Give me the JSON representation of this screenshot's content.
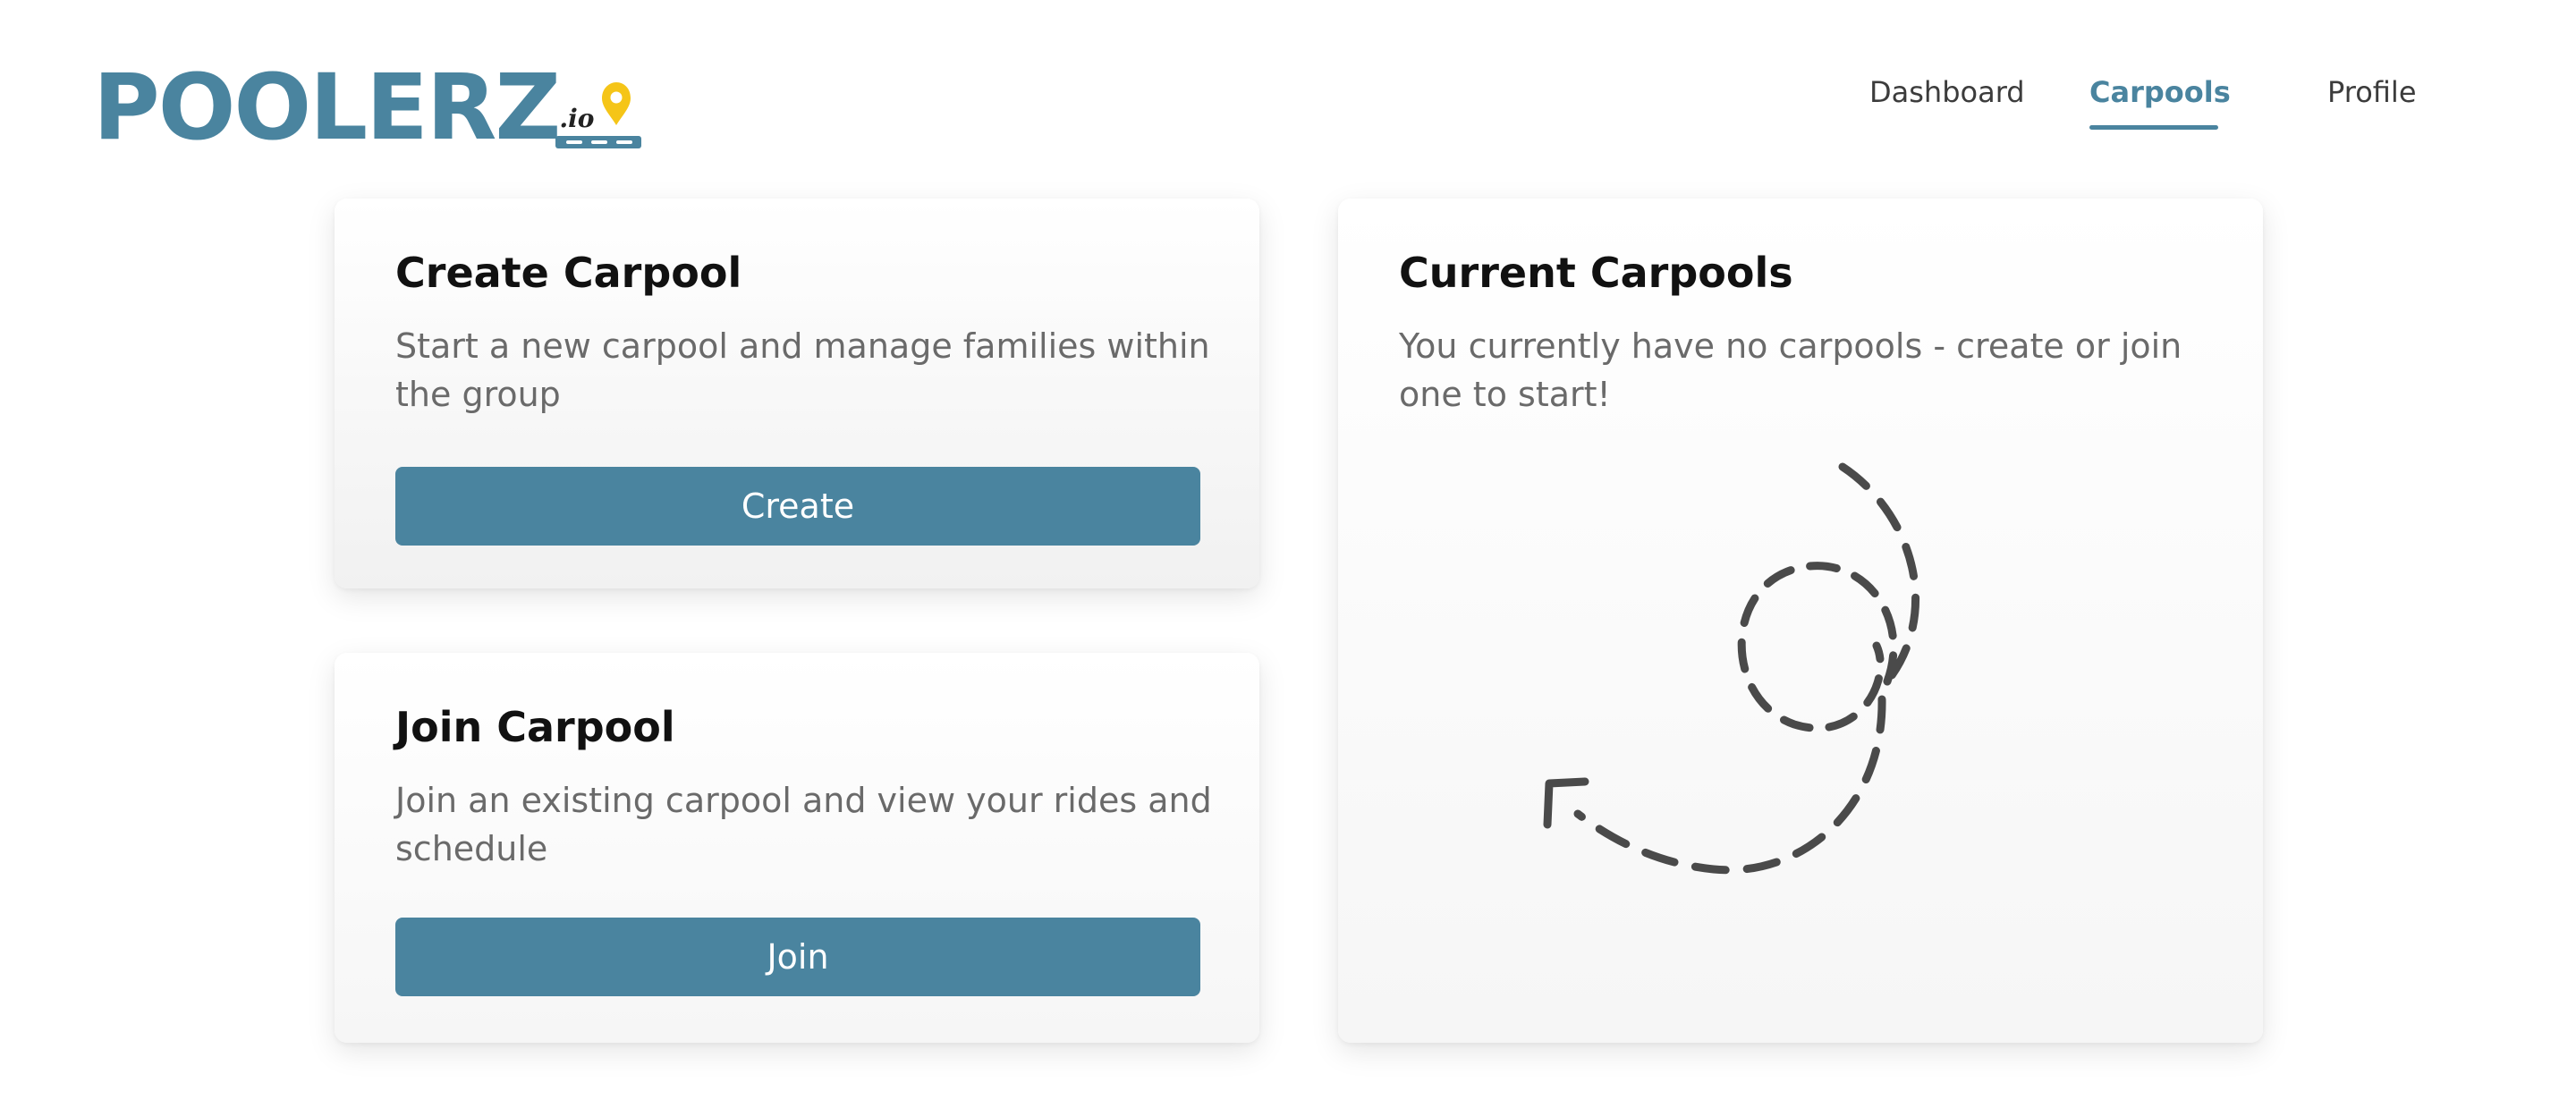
{
  "brand": {
    "name": "POOLERZ",
    "suffix": ".io",
    "accent": "#4a849f",
    "pin_color": "#f5c518"
  },
  "nav": {
    "items": [
      {
        "label": "Dashboard",
        "active": false
      },
      {
        "label": "Carpools",
        "active": true
      },
      {
        "label": "Profile",
        "active": false
      }
    ]
  },
  "create_card": {
    "title": "Create Carpool",
    "description": "Start a new carpool and manage families within the group",
    "button_label": "Create"
  },
  "join_card": {
    "title": "Join Carpool",
    "description": "Join an existing carpool and view your rides and schedule",
    "button_label": "Join"
  },
  "current_card": {
    "title": "Current Carpools",
    "empty_message": "You currently have no carpools - create or join one to start!",
    "illustration_icon": "dashed-loop-arrow-icon"
  }
}
